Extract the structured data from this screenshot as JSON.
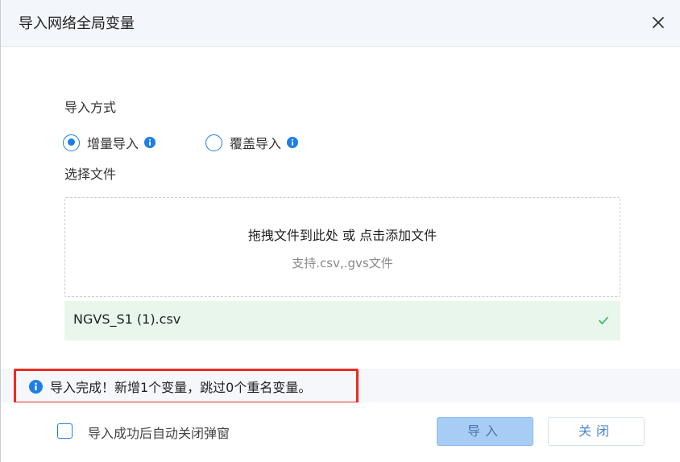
{
  "dialog": {
    "title": "导入网络全局变量"
  },
  "import_mode": {
    "label": "导入方式",
    "options": [
      {
        "label": "增量导入",
        "selected": true
      },
      {
        "label": "覆盖导入",
        "selected": false
      }
    ]
  },
  "file_select": {
    "label": "选择文件",
    "drop_text": "拖拽文件到此处 或 点击添加文件",
    "hint": "支持.csv,.gvs文件",
    "uploaded_file": "NGVS_S1 (1).csv"
  },
  "message": {
    "text": "导入完成！新增1个变量，跳过0个重名变量。"
  },
  "footer": {
    "auto_close_label": "导入成功后自动关闭弹窗",
    "auto_close_checked": false,
    "import_button": "导入",
    "close_button": "关闭"
  },
  "icons": {
    "close": "close-icon",
    "info": "info-icon",
    "check": "check-icon"
  },
  "colors": {
    "accent": "#1d7ee8",
    "success_bg": "#e9f6ec",
    "success_check": "#2fb858",
    "highlight_border": "#ee2a24",
    "import_button_bg": "#a8cdf4"
  }
}
